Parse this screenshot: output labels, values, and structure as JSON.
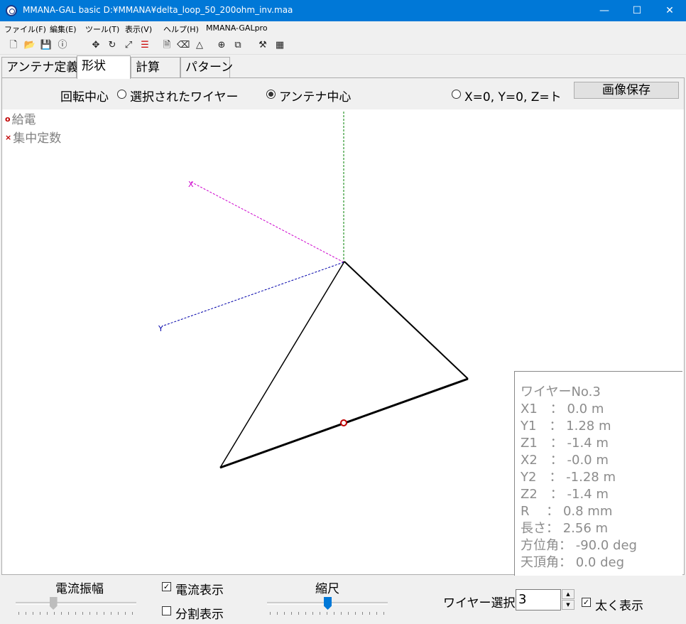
{
  "window": {
    "title": "MMANA-GAL basic D:¥MMANA¥delta_loop_50_200ohm_inv.maa",
    "minimize": "—",
    "maximize": "☐",
    "close": "✕"
  },
  "menu": [
    "ファイル(F)",
    "編集(E)",
    "ツール(T)",
    "表示(V)",
    "ヘルプ(H)",
    "MMANA-GALpro"
  ],
  "toolbar_icons": [
    "new-file-icon",
    "open-folder-icon",
    "save-icon",
    "info-icon",
    "move-icon",
    "rotate-icon",
    "zoom-icon",
    "wires-icon",
    "document-icon",
    "eraser-icon",
    "triangle-icon",
    "target-icon",
    "copy-icon",
    "tools-icon",
    "calculator-icon"
  ],
  "tabs": [
    "アンテナ定義",
    "形状",
    "計算",
    "パターン"
  ],
  "active_tab": "形状",
  "rotation": {
    "label": "回転中心",
    "option_selected_wire": "選択されたワイヤー",
    "option_antenna_center": "アンテナ中心",
    "option_origin": "X=0, Y=0, Z=ト",
    "selected": "アンテナ中心"
  },
  "save_image_button": "画像保存",
  "legend": {
    "feed_marker": "o",
    "feed_label": "給電",
    "load_marker": "×",
    "load_label": "集中定数"
  },
  "axes": {
    "x_label": "X",
    "y_label": "Y"
  },
  "colors": {
    "feed": "#c00000",
    "z_axis": "#008000",
    "x_axis": "#cc00cc",
    "y_axis": "#0000aa",
    "wire": "#000000",
    "slider_thumb_active": "#0078d7"
  },
  "wire_info": {
    "title": "ワイヤーNo.3",
    "lines": [
      "X1　：  0.0 m",
      "Y1　：  1.28 m",
      "Z1　：  -1.4 m",
      "X2　：  -0.0 m",
      "Y2　：  -1.28 m",
      "Z2　：  -1.4 m",
      "R　 ：  0.8 mm",
      "長さ：  2.56 m",
      "方位角：  -90.0 deg",
      "天頂角：  0.0 deg"
    ]
  },
  "bottom": {
    "current_amplitude_label": "電流振幅",
    "current_amplitude_level": 0.3,
    "show_current_label": "電流表示",
    "show_current_checked": true,
    "show_segments_label": "分割表示",
    "show_segments_checked": false,
    "scale_label": "縮尺",
    "scale_level": 0.5,
    "wire_select_label": "ワイヤー選択",
    "wire_select_value": "3",
    "bold_display_label": "太く表示",
    "bold_display_checked": true,
    "spin_up": "▲",
    "spin_down": "▼"
  }
}
